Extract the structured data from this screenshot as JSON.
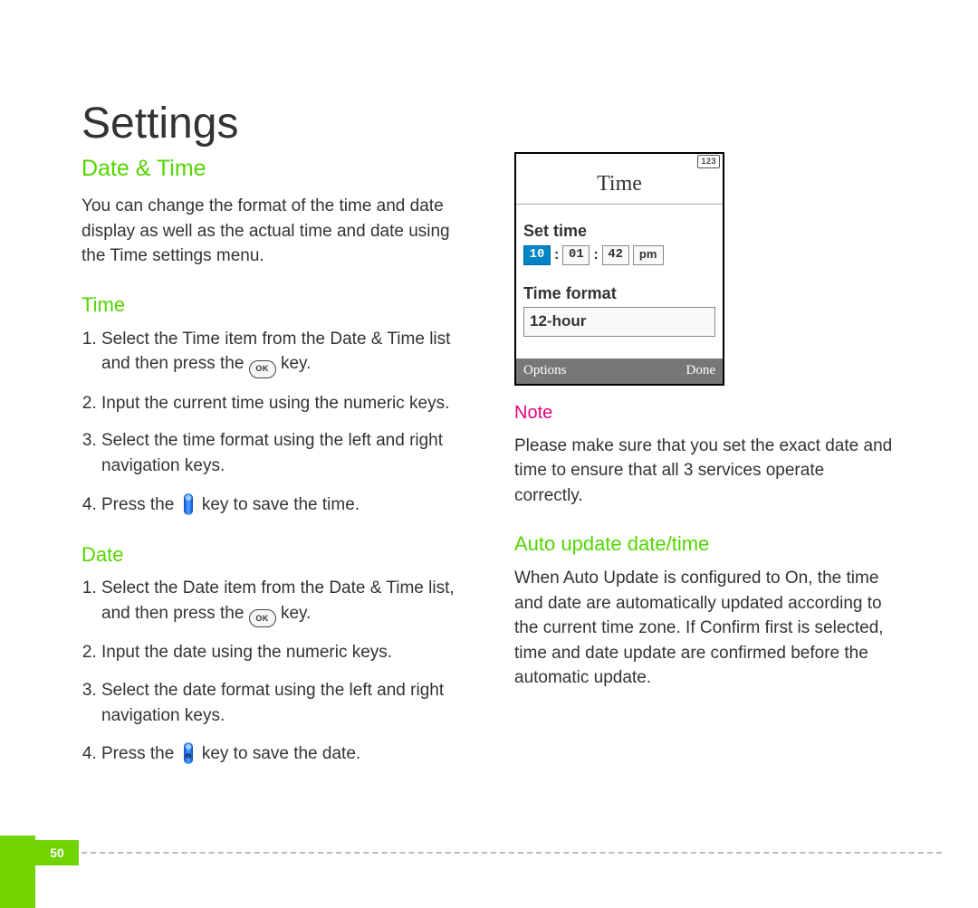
{
  "page_title": "Settings",
  "page_number": "50",
  "left": {
    "section_heading": "Date & Time",
    "intro": "You can change the format of the time and date display as well as the actual time and date using the Time settings menu.",
    "time_heading": "Time",
    "time_steps_1a": "Select the Time item from the Date & Time list and then press the ",
    "time_steps_1b": " key.",
    "time_steps_2": "Input the current time using the numeric keys.",
    "time_steps_3": "Select the time format using the left and right navigation keys.",
    "time_steps_4a": "Press the ",
    "time_steps_4b": " key to save the time.",
    "date_heading": "Date",
    "date_steps_1a": "Select the Date item from the Date & Time list, and then press the ",
    "date_steps_1b": " key.",
    "date_steps_2": "Input the date using the numeric keys.",
    "date_steps_3": "Select the date format using the left and right navigation keys.",
    "date_steps_4a": "Press the ",
    "date_steps_4b": " key to save the date."
  },
  "right": {
    "note_heading": "Note",
    "note_body": "Please make sure that you set the exact date and time to ensure that all 3 services operate correctly.",
    "auto_heading": "Auto update date/time",
    "auto_body": "When Auto Update is configured to On, the time and date are automatically updated according to the current time zone. If Confirm first is selected, time and date update are confirmed before the automatic update."
  },
  "phone": {
    "status_badge": "123",
    "title": "Time",
    "set_time_label": "Set time",
    "hh": "10",
    "mm": "01",
    "ss": "42",
    "ampm": "pm",
    "format_label": "Time format",
    "format_value": "12-hour",
    "soft_left": "Options",
    "soft_right": "Done"
  },
  "ok_label": "OK"
}
